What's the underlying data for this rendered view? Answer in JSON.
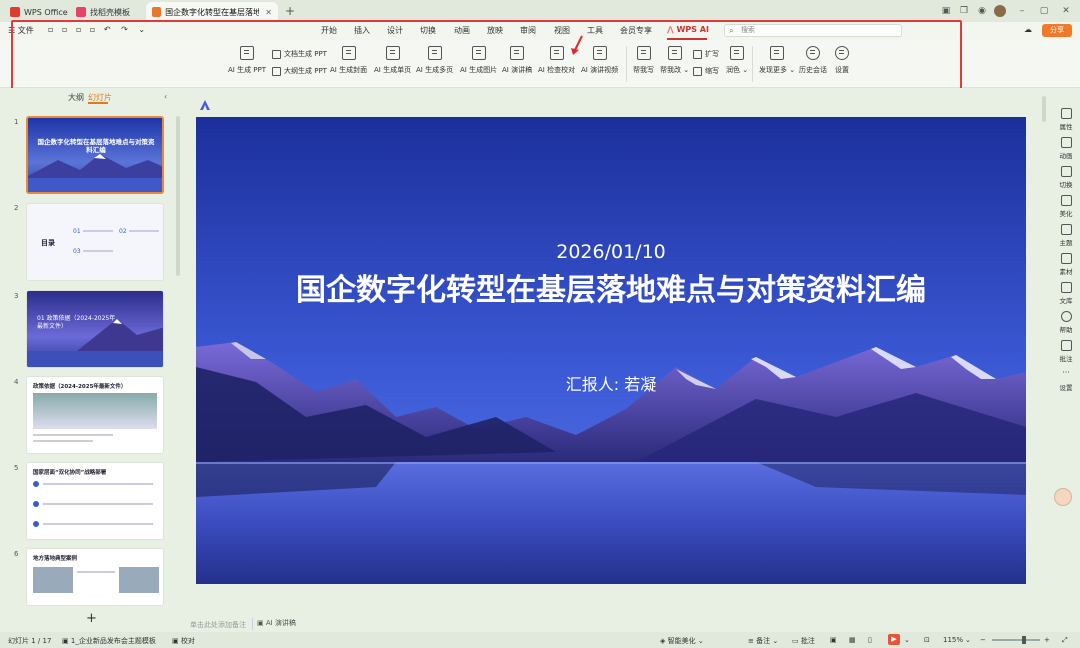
{
  "titlebar": {
    "tabs": [
      {
        "label": "WPS Office",
        "icon": "wps-logo-icon",
        "color": "#e23b2e"
      },
      {
        "label": "找稻壳模板",
        "icon": "docer-icon",
        "color": "#e8416b"
      },
      {
        "label": "国企数字化转型在基层落地难点与",
        "icon": "ppt-icon",
        "color": "#e8762d"
      }
    ],
    "new_tab": "+"
  },
  "menu": {
    "file": "文件",
    "items": [
      "开始",
      "插入",
      "设计",
      "切换",
      "动画",
      "放映",
      "审阅",
      "视图",
      "工具",
      "会员专享",
      "WPS AI"
    ],
    "search_placeholder": "搜索",
    "share": "分享"
  },
  "ribbon": {
    "ai_ppt": "AI 生成 PPT",
    "doc_ppt": "文档生成 PPT",
    "outline_ppt": "大纲生成 PPT",
    "cover": "AI 生成封面",
    "single": "AI 生成单页",
    "multi": "AI 生成多页",
    "image": "AI 生成图片",
    "script": "AI 演讲稿",
    "check": "AI 检查校对",
    "video": "AI 演讲视频",
    "write": "帮我写",
    "rewrite": "帮我改",
    "expand": "扩写",
    "shrink": "缩写",
    "polish": "润色",
    "more": "发现更多",
    "history": "历史会话",
    "settings": "设置"
  },
  "leftpanel": {
    "tab_outline": "大纲",
    "tab_slides": "幻灯片",
    "slides": [
      {
        "num": "1",
        "title": "国企数字化转型在基层落地难点与对策资料汇编"
      },
      {
        "num": "2",
        "title": "目录",
        "items": [
          "01",
          "02",
          "03"
        ]
      },
      {
        "num": "3",
        "title": "01 政策依据（2024-2025年最新文件）"
      },
      {
        "num": "4",
        "title": "政策依据（2024-2025年最新文件）"
      },
      {
        "num": "5",
        "title": "国家层面“双化协同”战略部署"
      },
      {
        "num": "6",
        "title": "地方落地典型案例"
      }
    ],
    "add": "+"
  },
  "slide": {
    "date": "2026/01/10",
    "title": "国企数字化转型在基层落地难点与对策资料汇编",
    "reporter": "汇报人: 若凝",
    "sky_top": "#1c2f9c",
    "sky_bottom": "#4a6ee0"
  },
  "notes": {
    "placeholder": "单击此处添加备注",
    "ai_script": "AI 演讲稿"
  },
  "rightbar": [
    "属性",
    "动画",
    "切换",
    "美化",
    "主题",
    "素材",
    "文库",
    "帮助",
    "批注",
    "设置"
  ],
  "status": {
    "slide_count": "幻灯片 1 / 17",
    "theme": "1_企业新品发布会主题模板",
    "proofread": "校对",
    "beautify": "智能美化",
    "notes": "备注",
    "comments": "批注",
    "zoom": "115%"
  },
  "colors": {
    "accent": "#e8893a",
    "highlight_box": "#e03a3a",
    "share": "#f07a2a"
  }
}
